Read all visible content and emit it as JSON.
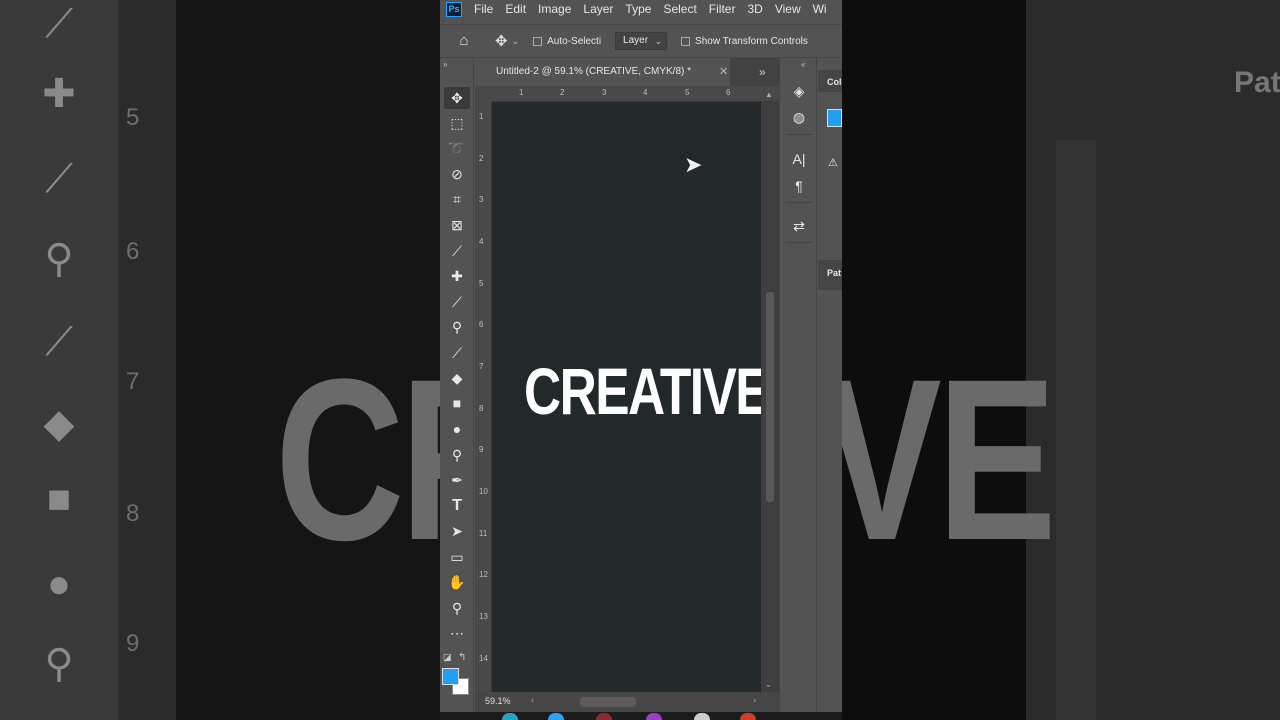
{
  "menubar": {
    "logo": "Ps",
    "items": [
      "File",
      "Edit",
      "Image",
      "Layer",
      "Type",
      "Select",
      "Filter",
      "3D",
      "View",
      "Wi"
    ]
  },
  "options": {
    "auto_select_label": "Auto-Selecti",
    "target_value": "Layer",
    "transform_label": "Show Transform Controls"
  },
  "document": {
    "tab_title": "Untitled-2 @ 59.1% (CREATIVE, CMYK/8) *",
    "text_layer": "CREATIVE",
    "zoom": "59.1%",
    "h_ruler": [
      "1",
      "2",
      "3",
      "4",
      "5",
      "6"
    ],
    "v_ruler": [
      "1",
      "2",
      "3",
      "4",
      "5",
      "6",
      "7",
      "8",
      "9",
      "10",
      "11",
      "12",
      "13",
      "14"
    ]
  },
  "colors": {
    "foreground": "#21a0f2",
    "background": "#ffffff",
    "canvas": "#23282a"
  },
  "panels": {
    "color_label": "Col",
    "paths_label": "Pat"
  },
  "backdrop": {
    "big_text_left": "CR",
    "big_text_right": "VE",
    "ruler_numbers": [
      "5",
      "6",
      "7",
      "8",
      "9"
    ],
    "panel_label": "Pat"
  },
  "tools": [
    "move-tool",
    "marquee-tool",
    "lasso-tool",
    "quick-select-tool",
    "crop-tool",
    "frame-tool",
    "eyedropper-tool",
    "healing-tool",
    "brush-tool",
    "stamp-tool",
    "history-brush-tool",
    "eraser-tool",
    "gradient-tool",
    "blur-tool",
    "dodge-tool",
    "pen-tool",
    "type-tool",
    "path-select-tool",
    "shape-tool",
    "hand-tool",
    "zoom-tool",
    "more-tools"
  ]
}
